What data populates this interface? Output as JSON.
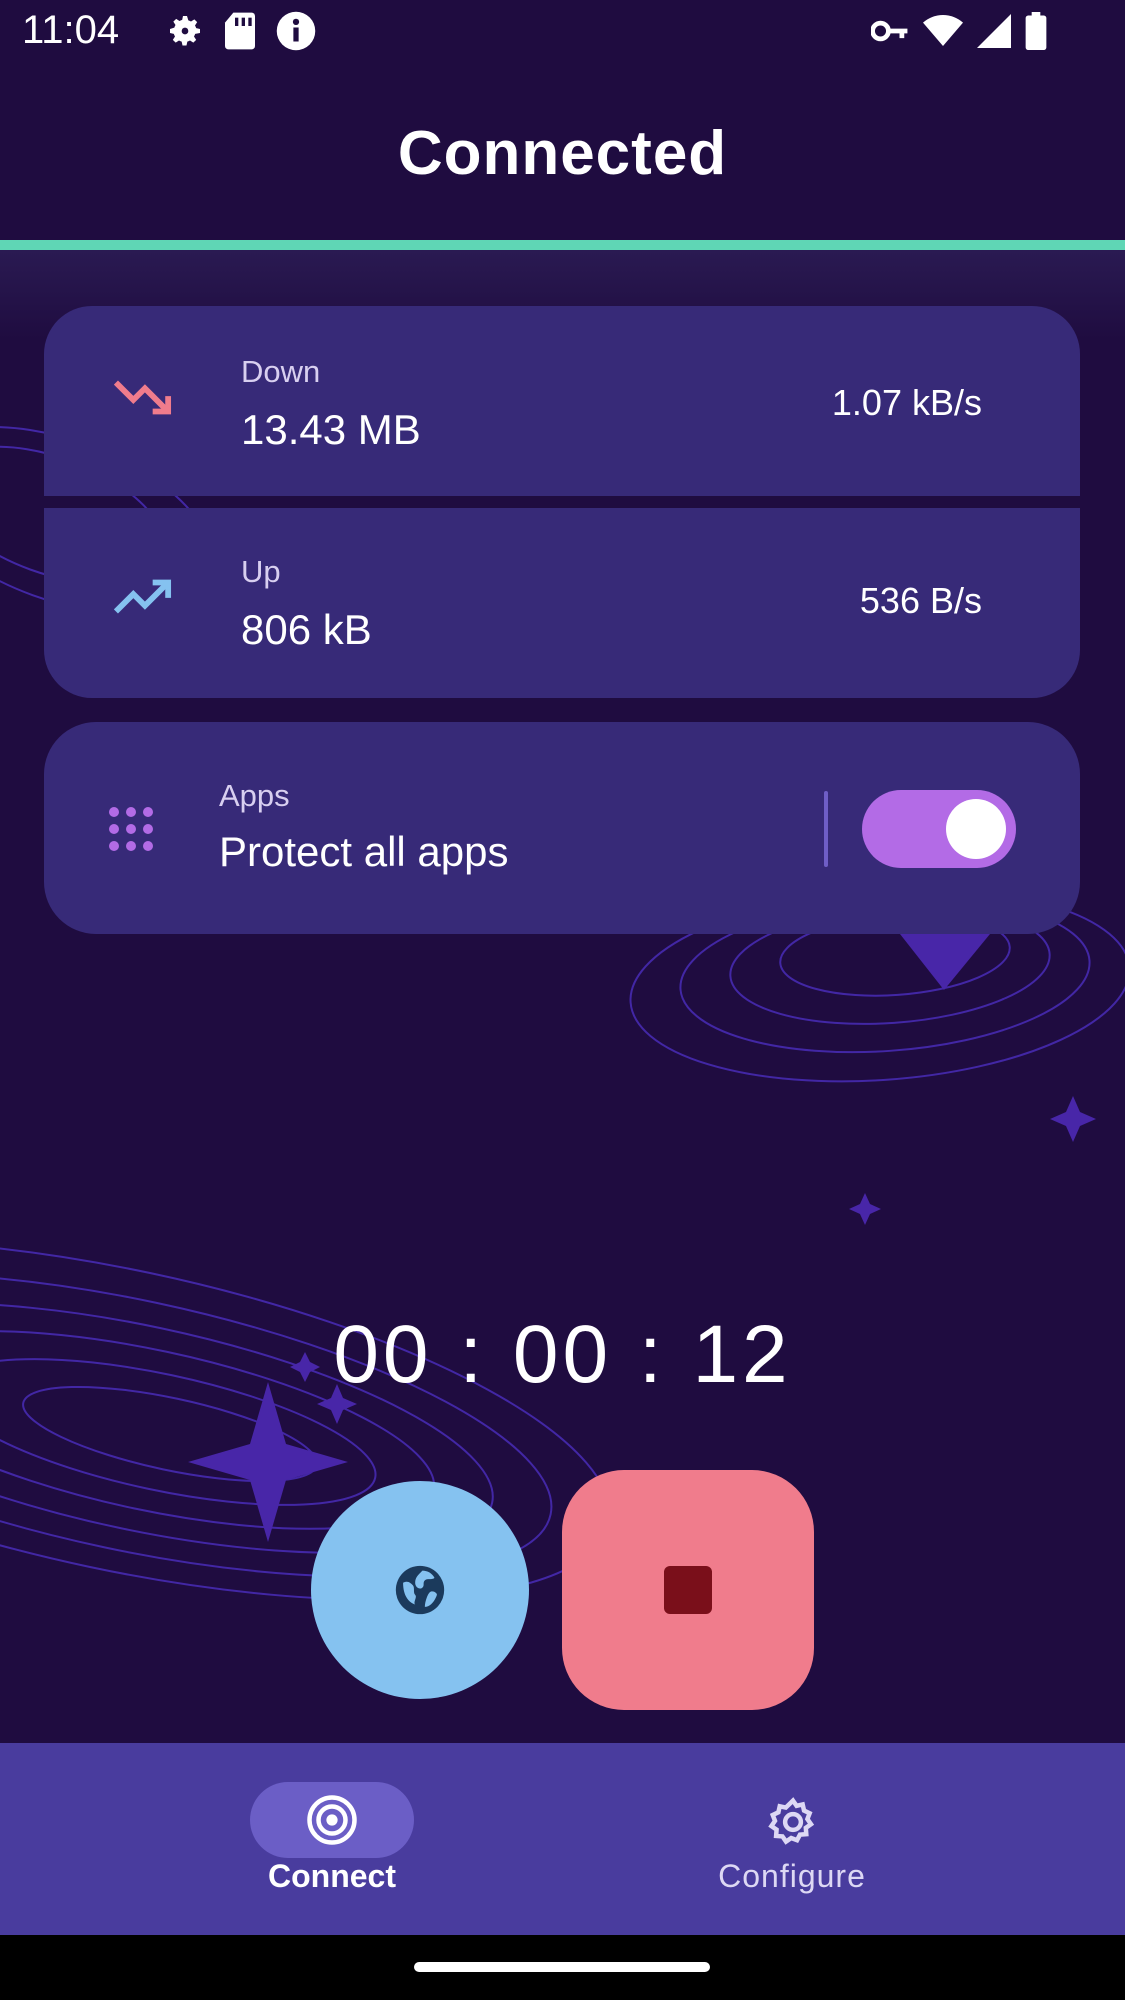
{
  "status_bar": {
    "time": "11:04",
    "left_icons": [
      "settings-icon",
      "sd-card-icon",
      "info-icon"
    ],
    "right_icons": [
      "vpn-key-icon",
      "wifi-icon",
      "signal-icon",
      "battery-icon"
    ]
  },
  "header": {
    "title": "Connected"
  },
  "traffic": {
    "down": {
      "label": "Down",
      "total": "13.43 MB",
      "rate": "1.07 kB/s",
      "icon": "trending-down-icon",
      "color": "#f07c8c"
    },
    "up": {
      "label": "Up",
      "total": "806 kB",
      "rate": "536 B/s",
      "icon": "trending-up-icon",
      "color": "#85c2f0"
    }
  },
  "apps": {
    "label": "Apps",
    "value": "Protect all apps",
    "toggle_on": true,
    "icon": "apps-grid-icon"
  },
  "timer": {
    "text": "00 : 00 : 12"
  },
  "actions": {
    "globe_icon": "globe-icon",
    "stop_icon": "stop-icon"
  },
  "nav": {
    "items": [
      {
        "label": "Connect",
        "icon": "connect-icon",
        "active": true
      },
      {
        "label": "Configure",
        "icon": "gear-icon",
        "active": false
      }
    ]
  },
  "colors": {
    "background": "#1f0c40",
    "card": "#372a78",
    "accent_line": "#5fd6b5",
    "navbar": "#493c9e"
  }
}
